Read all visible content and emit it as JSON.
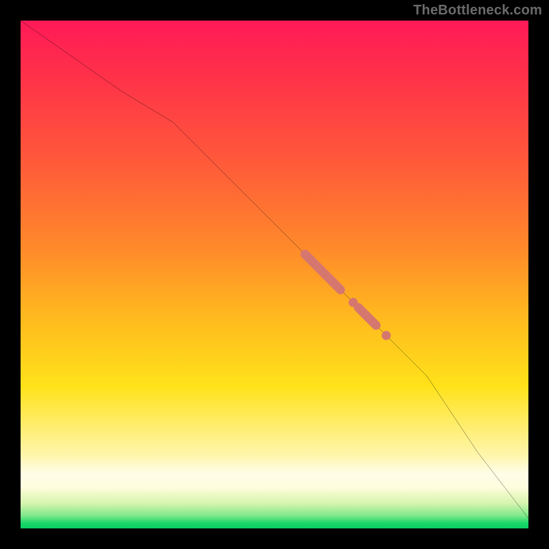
{
  "watermark": "TheBottleneck.com",
  "colors": {
    "frame": "#000000",
    "line": "#000000",
    "marker": "#d6776f"
  },
  "chart_data": {
    "type": "line",
    "title": "",
    "xlabel": "",
    "ylabel": "",
    "xlim": [
      0,
      100
    ],
    "ylim": [
      0,
      100
    ],
    "grid": false,
    "legend": false,
    "series": [
      {
        "name": "curve",
        "x": [
          0,
          10,
          20,
          30,
          40,
          50,
          60,
          70,
          80,
          90,
          100
        ],
        "values": [
          100,
          93,
          86,
          80,
          70,
          60,
          50,
          40,
          30,
          15,
          2
        ]
      }
    ],
    "markers": [
      {
        "name": "segment-a",
        "type": "segment",
        "x0": 56,
        "y0": 54,
        "x1": 63,
        "y1": 47
      },
      {
        "name": "dot-b",
        "type": "dot",
        "x": 65.5,
        "y": 44.5
      },
      {
        "name": "segment-c",
        "type": "segment",
        "x0": 66.5,
        "y0": 43.5,
        "x1": 70,
        "y1": 40
      },
      {
        "name": "dot-d",
        "type": "dot",
        "x": 72,
        "y": 38
      }
    ]
  }
}
